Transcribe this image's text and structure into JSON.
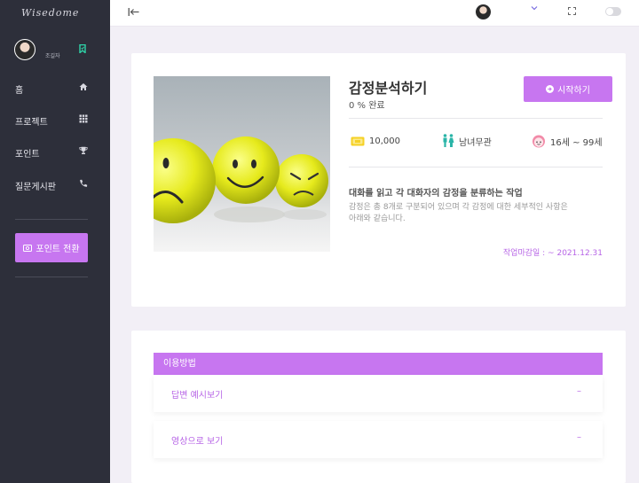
{
  "brand": {
    "logo_text": "Wisedome"
  },
  "sidebar": {
    "profile_name": "조길자",
    "items": [
      {
        "label": "홈",
        "icon": "home-icon"
      },
      {
        "label": "프로젝트",
        "icon": "grid-icon"
      },
      {
        "label": "포인트",
        "icon": "trophy-icon"
      },
      {
        "label": "질문게시판",
        "icon": "phone-icon"
      }
    ],
    "convert_button": "포인트 전환"
  },
  "topbar": {
    "collapse_icon": "collapse-left-icon"
  },
  "task": {
    "title": "감정분석하기",
    "progress": "0 % 완료",
    "start_button": "시작하기",
    "points": "10,000",
    "gender": "남녀무관",
    "age": "16세 ~ 99세",
    "desc_title": "대화를 읽고 각 대화자의 감정을 분류하는 작업",
    "desc_line1": "감정은 총 8개로 구분되어 있으며 각 감정에 대한 세부적인 사항은",
    "desc_line2": "아래와 같습니다.",
    "deadline": "작업마감일 : ~ 2021.12.31"
  },
  "usage": {
    "header": "이용방법",
    "items": [
      {
        "label": "답변 예시보기",
        "sign": "–"
      },
      {
        "label": "영상으로 보기",
        "sign": "–"
      }
    ]
  },
  "colors": {
    "accent": "#c776f0",
    "sidebar": "#2d2f3a",
    "background": "#f2eff6"
  }
}
